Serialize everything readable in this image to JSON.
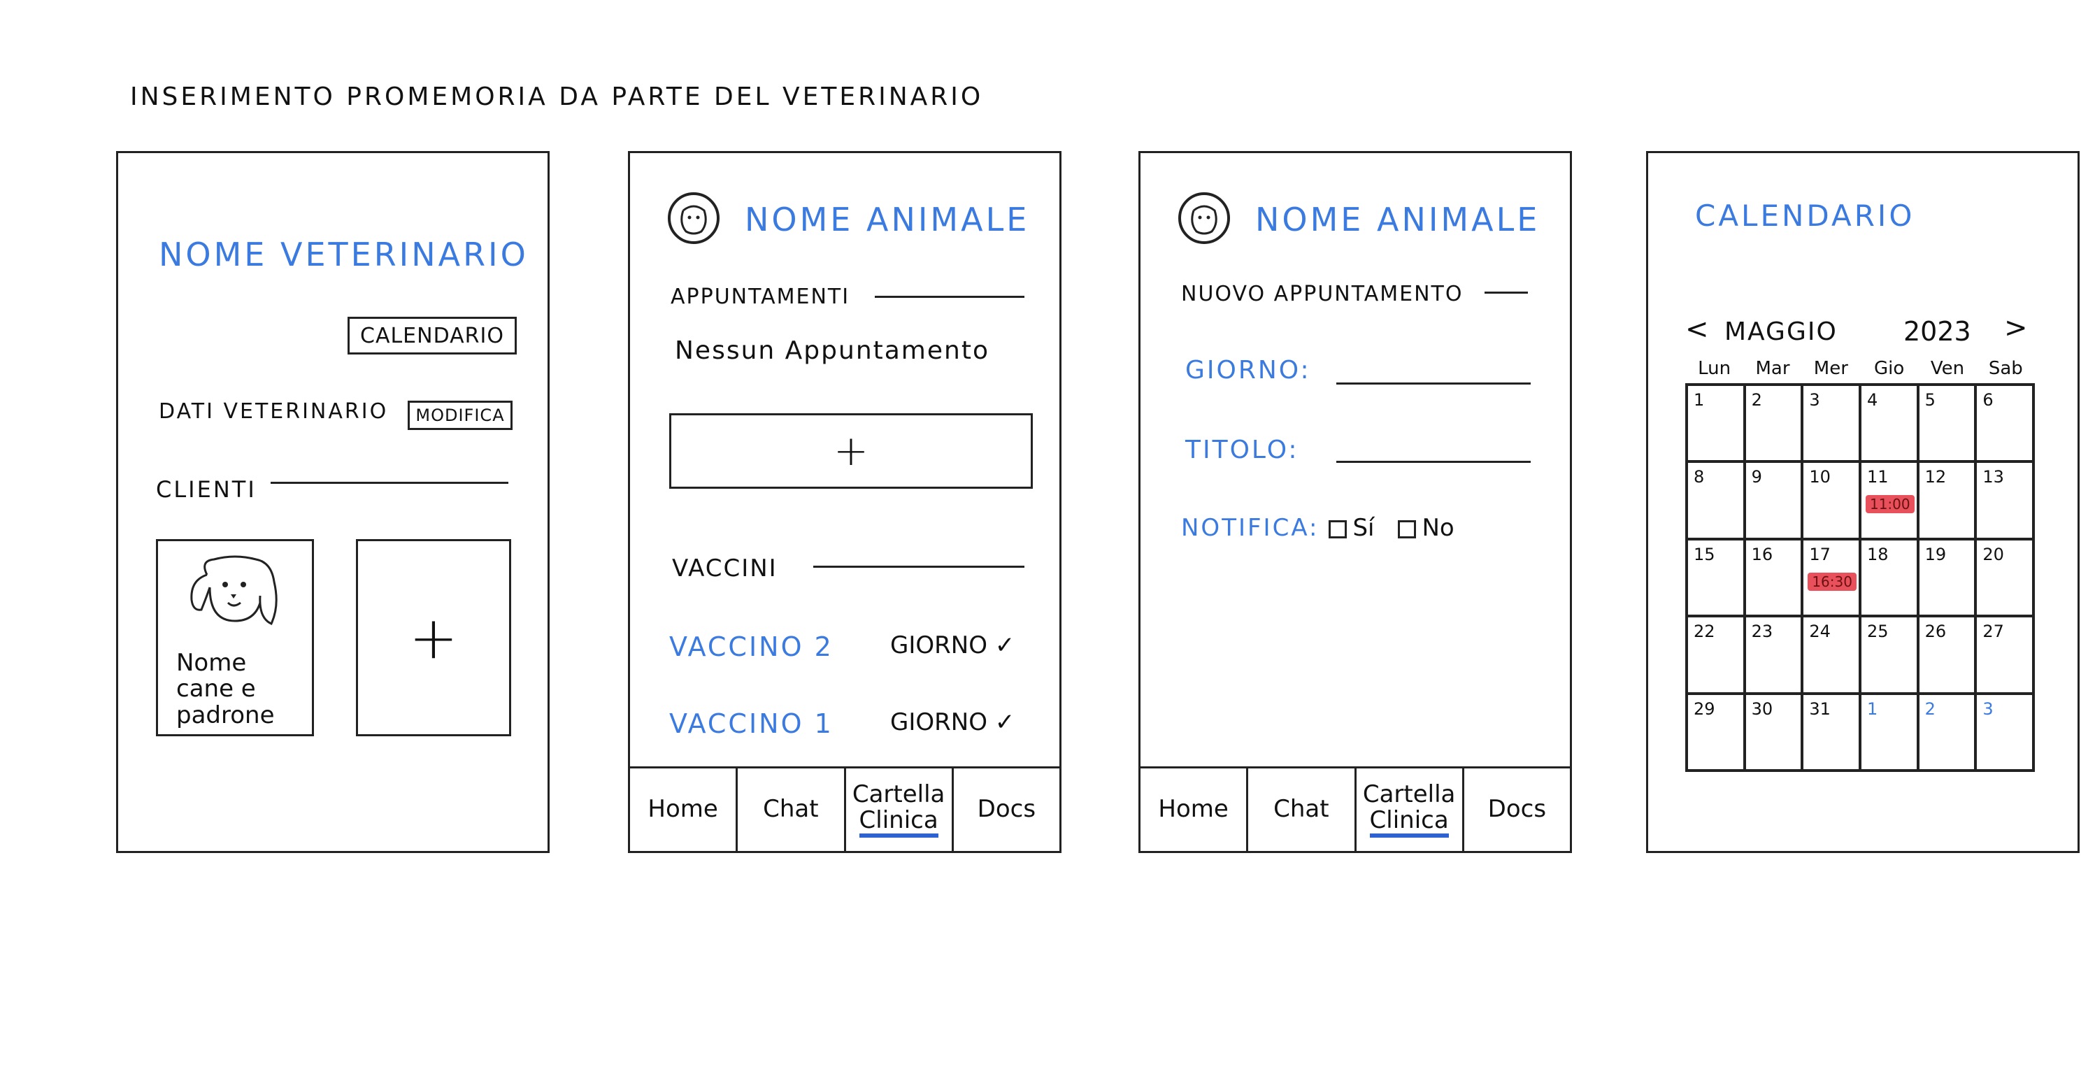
{
  "page_title": "INSERIMENTO PROMEMORIA DA PARTE DEL VETERINARIO",
  "screen1": {
    "vet_name": "NOME VETERINARIO",
    "calendar_button": "CALENDARIO",
    "vet_data_label": "DATI VETERINARIO",
    "edit_button": "MODIFICA",
    "clients_label": "CLIENTI",
    "client_card_text": "Nome cane e padrone",
    "add_client": "+"
  },
  "screen2": {
    "animal_name": "NOME ANIMALE",
    "appointments_label": "APPUNTAMENTI",
    "no_appointments": "Nessun Appuntamento",
    "add_appointment": "+",
    "vaccines_label": "VACCINI",
    "vaccines": [
      {
        "name": "VACCINO 2",
        "day": "GIORNO ✓"
      },
      {
        "name": "VACCINO 1",
        "day": "GIORNO ✓"
      }
    ]
  },
  "screen3": {
    "animal_name": "NOME ANIMALE",
    "new_appointment_label": "NUOVO APPUNTAMENTO",
    "day_label": "GIORNO:",
    "title_label": "TITOLO:",
    "notification_label": "NOTIFICA:",
    "opt_yes": "Sí",
    "opt_no": "No"
  },
  "nav": {
    "home": "Home",
    "chat": "Chat",
    "cartella_1": "Cartella",
    "cartella_2": "Clinica",
    "docs": "Docs"
  },
  "screen4": {
    "title": "CALENDARIO",
    "prev": "<",
    "month": "MAGGIO",
    "year": "2023",
    "next": ">",
    "weekdays": [
      "Lun",
      "Mar",
      "Mer",
      "Gio",
      "Ven",
      "Sab"
    ],
    "days": [
      "1",
      "2",
      "3",
      "4",
      "5",
      "6",
      "8",
      "9",
      "10",
      "11",
      "12",
      "13",
      "15",
      "16",
      "17",
      "18",
      "19",
      "20",
      "22",
      "23",
      "24",
      "25",
      "26",
      "27",
      "29",
      "30",
      "31",
      "1",
      "2",
      "3"
    ],
    "events": {
      "11": "11:00",
      "17": "16:30"
    }
  },
  "colors": {
    "accent": "#3b7be0",
    "event": "#e8505b",
    "underline": "#2e62d1"
  }
}
